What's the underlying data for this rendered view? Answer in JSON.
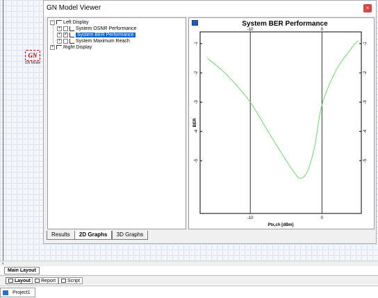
{
  "window": {
    "title": "GN Model Viewer",
    "close_glyph": "×"
  },
  "canvas_component": {
    "glyph": "GN",
    "caption": "GN Model"
  },
  "tree": {
    "left_display": "Left Display",
    "items": [
      {
        "label": "System OSNR Performance",
        "checked": false,
        "selected": false
      },
      {
        "label": "System BER Performance",
        "checked": true,
        "selected": true
      },
      {
        "label": "System Maximum Reach",
        "checked": false,
        "selected": false
      }
    ],
    "right_display": "Right Display"
  },
  "viewer_tabs": [
    "Results",
    "2D Graphs",
    "3D Graphs"
  ],
  "active_viewer_tab": "2D Graphs",
  "layout_tab": "Main Layout",
  "view_buttons": [
    "Layout",
    "Report",
    "Script"
  ],
  "project_tab": "Project1",
  "colors": {
    "curve": "#66dd66",
    "selection": "#0a64d6",
    "close": "#e04343"
  },
  "chart_data": {
    "type": "line",
    "title": "System BER Performance",
    "xlabel": "Ptx,ch [dBm]",
    "ylabel": "BER",
    "xlim": [
      -17,
      5.5
    ],
    "ylim": [
      -6.8,
      -0.6
    ],
    "x_ticks": [
      -10,
      0
    ],
    "y_ticks": [
      -1,
      -2,
      -3,
      -4,
      -5
    ],
    "grid": false,
    "series": [
      {
        "x": [
          -16,
          -14,
          -12,
          -10,
          -8,
          -6,
          -4,
          -3,
          -2,
          -1,
          0,
          2,
          4,
          5
        ],
        "y": [
          -1.5,
          -1.9,
          -2.4,
          -3.0,
          -3.8,
          -4.6,
          -5.35,
          -5.6,
          -5.35,
          -4.5,
          -3.1,
          -1.9,
          -1.2,
          -0.9
        ]
      }
    ]
  }
}
